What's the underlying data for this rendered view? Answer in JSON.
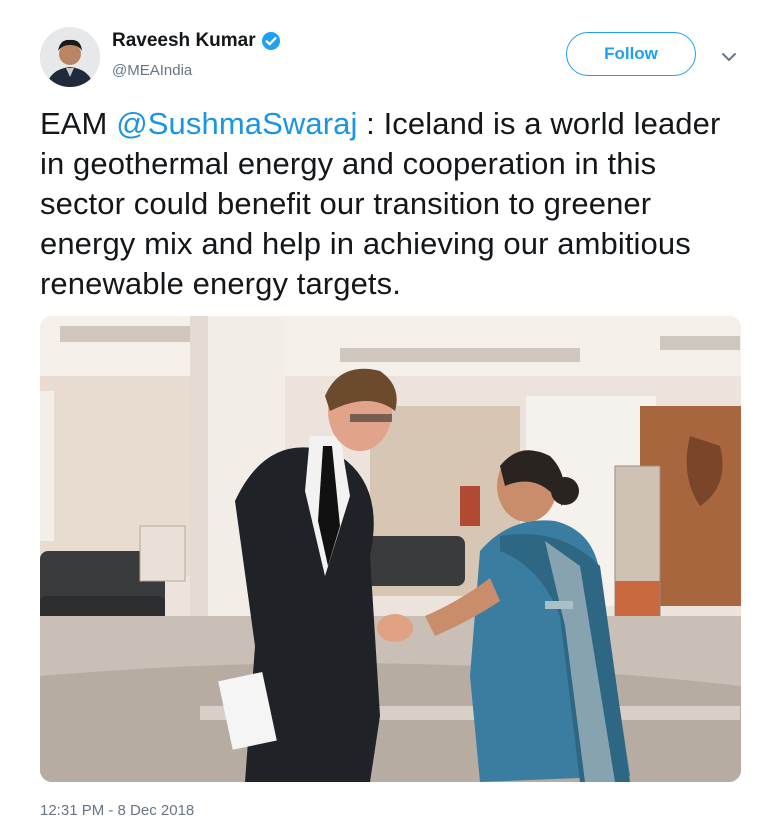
{
  "author": {
    "display_name": "Raveesh Kumar",
    "handle": "@MEAIndia",
    "verified": true
  },
  "follow_label": "Follow",
  "tweet": {
    "prefix": "EAM ",
    "mention": "@SushmaSwaraj",
    "body": " : Iceland is a world leader in geothermal energy and cooperation in this sector could benefit our transition to greener energy mix and help in achieving our ambitious renewable energy targets."
  },
  "timestamp": "12:31 PM - 8 Dec 2018",
  "colors": {
    "accent": "#1da1f2",
    "mention": "#1b95e0",
    "muted": "#657786",
    "text": "#14171a"
  },
  "icons": {
    "verified": "verified-badge-icon",
    "caret": "chevron-down-icon"
  }
}
